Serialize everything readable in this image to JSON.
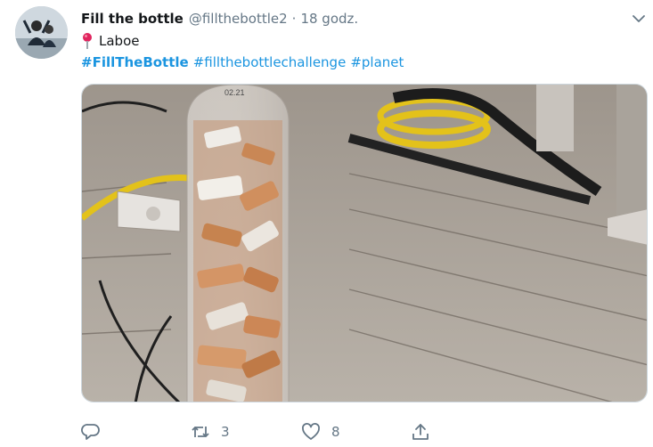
{
  "tweet": {
    "display_name": "Fill the bottle",
    "handle": "@fillthebottle2",
    "separator": "·",
    "time": "18 godz.",
    "location": "Laboe",
    "hashtags": [
      "#FillTheBottle",
      "#fillthebottlechallenge",
      "#planet"
    ],
    "media_alt": "",
    "icons": {
      "more": "chevron-down-icon",
      "location": "location-pin-icon",
      "reply": "reply-icon",
      "retweet": "retweet-icon",
      "like": "heart-icon",
      "share": "share-icon"
    },
    "colors": {
      "link": "#1b95e0",
      "secondary": "#657786",
      "pin": "#e0245e"
    }
  },
  "actions": {
    "reply_count": "",
    "retweet_count": "3",
    "like_count": "8"
  },
  "bottle_label_text": "02.21"
}
